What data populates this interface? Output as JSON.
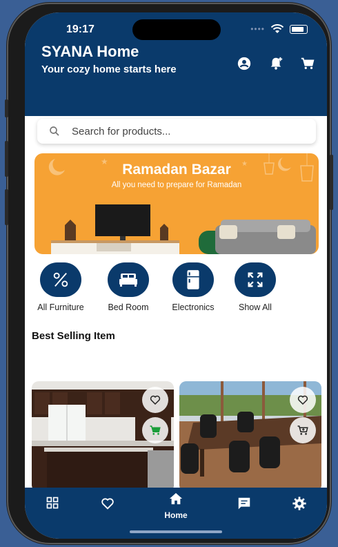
{
  "status_bar": {
    "time": "19:17"
  },
  "header": {
    "title": "SYANA Home",
    "subtitle": "Your cozy home starts here",
    "icons": [
      "account-circle-icon",
      "add-notification-icon",
      "cart-icon"
    ]
  },
  "search": {
    "placeholder": "Search for products..."
  },
  "banner": {
    "title": "Ramadan Bazar",
    "subtitle": "All you need to prepare for Ramadan"
  },
  "categories": [
    {
      "label": "All Furniture",
      "icon": "percent-icon"
    },
    {
      "label": "Bed Room",
      "icon": "bed-icon"
    },
    {
      "label": "Electronics",
      "icon": "fridge-icon"
    },
    {
      "label": "Show All",
      "icon": "expand-icon"
    }
  ],
  "section": {
    "title": "Best Selling Item"
  },
  "products": [
    {
      "image": "kitchen-cabinets",
      "actions": [
        "favorite-icon",
        "add-to-cart-icon"
      ]
    },
    {
      "image": "dining-table",
      "actions": [
        "favorite-icon",
        "add-to-cart-icon"
      ]
    }
  ],
  "bottom_nav": {
    "items": [
      {
        "icon": "grid-icon",
        "label": ""
      },
      {
        "icon": "heart-icon",
        "label": ""
      },
      {
        "icon": "home-icon",
        "label": "Home"
      },
      {
        "icon": "chat-icon",
        "label": ""
      },
      {
        "icon": "settings-icon",
        "label": ""
      }
    ]
  },
  "colors": {
    "primary": "#0a3a6b",
    "banner": "#f6a234",
    "background": "#3a5f95",
    "cart_green": "#1a9e3a"
  }
}
